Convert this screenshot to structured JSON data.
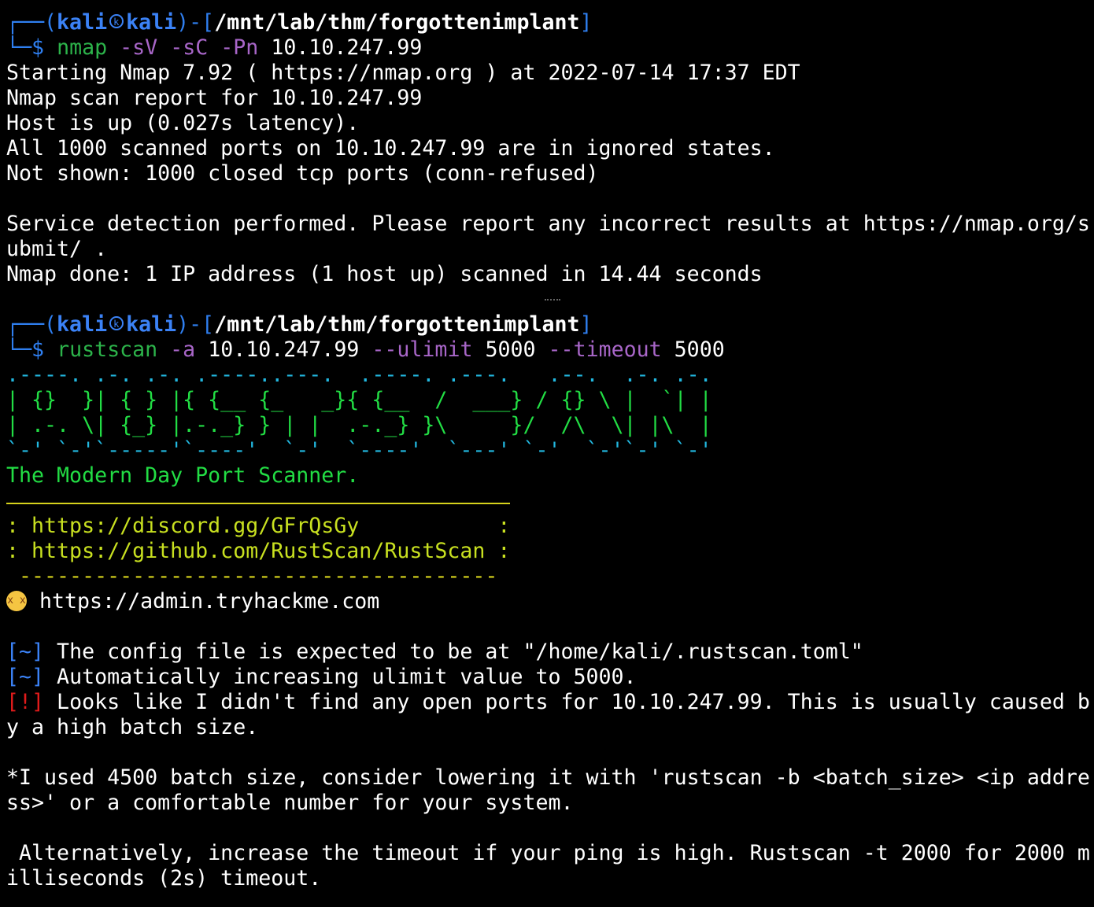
{
  "prompt1": {
    "frame_top": "┌──(",
    "user": "kali",
    "host": "kali",
    "sep": ")-[",
    "path": "/mnt/lab/thm/forgottenimplant",
    "close": "]",
    "frame_bottom": "└─$",
    "cmd": "nmap",
    "flag1": "-sV",
    "flag2": "-sC",
    "flag3": "-Pn",
    "arg": "10.10.247.99"
  },
  "nmap_output": [
    "Starting Nmap 7.92 ( https://nmap.org ) at 2022-07-14 17:37 EDT",
    "Nmap scan report for 10.10.247.99",
    "Host is up (0.027s latency).",
    "All 1000 scanned ports on 10.10.247.99 are in ignored states.",
    "Not shown: 1000 closed tcp ports (conn-refused)",
    "",
    "Service detection performed. Please report any incorrect results at https://nmap.org/s",
    "ubmit/ .",
    "Nmap done: 1 IP address (1 host up) scanned in 14.44 seconds"
  ],
  "prompt2": {
    "frame_top": "┌──(",
    "user": "kali",
    "host": "kali",
    "sep": ")-[",
    "path": "/mnt/lab/thm/forgottenimplant",
    "close": "]",
    "frame_bottom": "└─$",
    "cmd": "rustscan",
    "flag1": "-a",
    "arg1": "10.10.247.99",
    "flag2": "--ulimit",
    "arg2": "5000",
    "flag3": "--timeout",
    "arg3": "5000"
  },
  "ascii_art": [
    ".----. .-. .-. .----..---.  .----. .---.   .--.  .-. .-.",
    "| {}  }| { } |{ {__ {_   _}{ {__  /  ___} / {} \\ |  `| |",
    "| .-. \\| {_} |.-._} } | |  .-._} }\\     }/  /\\  \\| |\\  |",
    "`-' `-'`-----'`----'  `-'  `----'  `---' `-'  `-'`-' `-'"
  ],
  "tagline": "The Modern Day Port Scanner.",
  "links": [
    ": https://discord.gg/GFrQsGy           :",
    ": https://github.com/RustScan/RustScan :"
  ],
  "dash_rule": " --------------------------------------",
  "emoji_line": "https://admin.tryhackme.com",
  "messages": [
    {
      "tag": "[~]",
      "text": " The config file is expected to be at \"/home/kali/.rustscan.toml\"",
      "color": "#3b82f6"
    },
    {
      "tag": "[~]",
      "text": " Automatically increasing ulimit value to 5000.",
      "color": "#3b82f6"
    },
    {
      "tag": "[!]",
      "text": " Looks like I didn't find any open ports for 10.10.247.99. This is usually caused b",
      "color": "#e01b1b"
    }
  ],
  "message_cont": "y a high batch size.",
  "tail": [
    "*I used 4500 batch size, consider lowering it with 'rustscan -b <batch_size> <ip addre",
    "ss>' or a comfortable number for your system.",
    "",
    " Alternatively, increase the timeout if your ping is high. Rustscan -t 2000 for 2000 m",
    "illiseconds (2s) timeout."
  ]
}
